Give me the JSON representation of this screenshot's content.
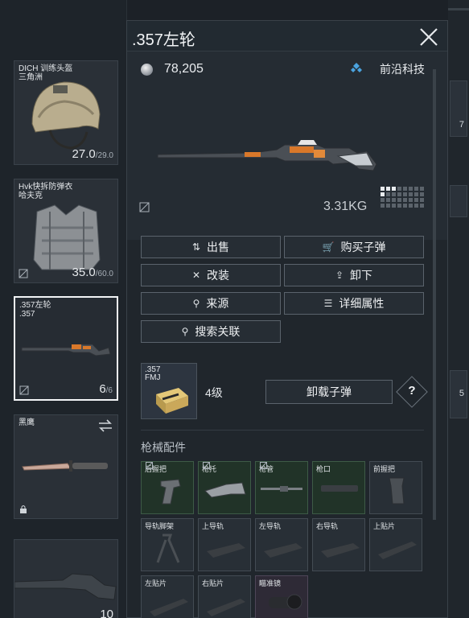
{
  "left_slots": [
    {
      "name": "DICH 训练头盔\n三角洲",
      "durability": "27.0",
      "max": "/29.0"
    },
    {
      "name": "Hvk快拆防弹衣\n哈夫克",
      "durability": "35.0",
      "max": "/60.0"
    },
    {
      "name": ".357左轮\n.357",
      "durability": "6",
      "max": "/6"
    },
    {
      "name": "黑鹰",
      "durability": "",
      "max": ""
    },
    {
      "name": "",
      "durability": "10",
      "max": ""
    }
  ],
  "right_strip": {
    "tab1": "7",
    "tab2": "5"
  },
  "panel": {
    "title": ".357左轮",
    "price": "78,205",
    "brand": "前沿科技",
    "weight": "3.31KG"
  },
  "actions": {
    "sell": "出售",
    "buy_ammo": "购买子弹",
    "modify": "改装",
    "unload": "卸下",
    "source": "来源",
    "details": "详细属性",
    "search_related": "搜索关联"
  },
  "ammo": {
    "label": ".357\nFMJ",
    "level": "4级",
    "unload_ammo": "卸载子弹",
    "help": "?"
  },
  "attachments": {
    "section_title": "枪械配件",
    "slots": [
      "后握把",
      "枪托",
      "枪管",
      "枪口",
      "前握把",
      "导轨脚架",
      "上导轨",
      "左导轨",
      "右导轨",
      "上贴片",
      "左贴片",
      "右贴片",
      "瞄准镜"
    ]
  },
  "colors": {
    "accent_blue": "#4aa3df",
    "filled_slot": "#213328",
    "panel_bg": "#20262c"
  }
}
